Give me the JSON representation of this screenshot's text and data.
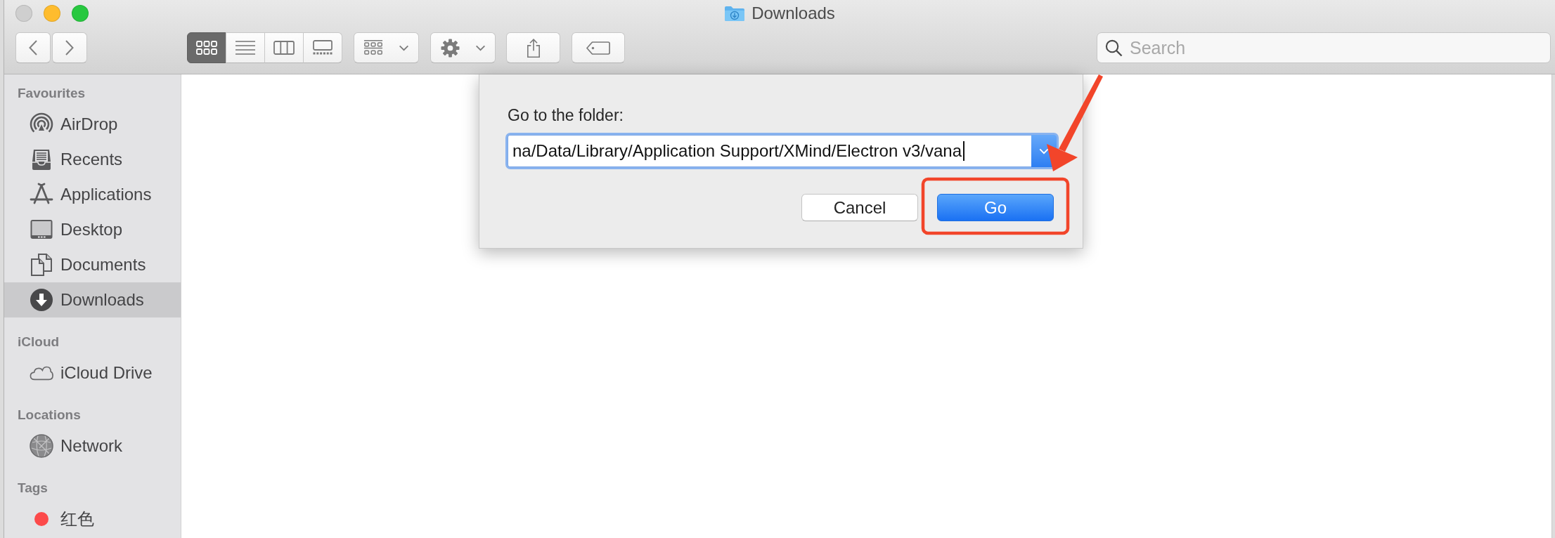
{
  "window": {
    "title": "Downloads"
  },
  "window_controls": [
    {
      "kind": "close",
      "disabled": true
    },
    {
      "kind": "minimize",
      "disabled": false
    },
    {
      "kind": "zoom",
      "disabled": false
    }
  ],
  "toolbar": {
    "view_modes": [
      {
        "kind": "icons",
        "selected": true
      },
      {
        "kind": "list",
        "selected": false
      },
      {
        "kind": "columns",
        "selected": false
      },
      {
        "kind": "gallery",
        "selected": false
      }
    ]
  },
  "search": {
    "placeholder": "Search"
  },
  "sidebar": {
    "sections": [
      {
        "title": "Favourites",
        "items": [
          {
            "label": "AirDrop",
            "kind": "airdrop",
            "selected": false
          },
          {
            "label": "Recents",
            "kind": "recents",
            "selected": false
          },
          {
            "label": "Applications",
            "kind": "applications",
            "selected": false
          },
          {
            "label": "Desktop",
            "kind": "desktop",
            "selected": false
          },
          {
            "label": "Documents",
            "kind": "documents",
            "selected": false
          },
          {
            "label": "Downloads",
            "kind": "downloads",
            "selected": true
          }
        ]
      },
      {
        "title": "iCloud",
        "items": [
          {
            "label": "iCloud Drive",
            "kind": "icloud",
            "selected": false
          }
        ]
      },
      {
        "title": "Locations",
        "items": [
          {
            "label": "Network",
            "kind": "network",
            "selected": false
          }
        ]
      },
      {
        "title": "Tags",
        "items": [
          {
            "label": "红色",
            "kind": "tag",
            "color": "#fc4a4a",
            "selected": false
          }
        ]
      }
    ]
  },
  "dialog": {
    "prompt": "Go to the folder:",
    "path_field": {
      "value": "na/Data/Library/Application Support/XMind/Electron v3/vana"
    },
    "buttons": [
      {
        "label": "Cancel",
        "primary": false
      },
      {
        "label": "Go",
        "primary": true
      }
    ]
  }
}
